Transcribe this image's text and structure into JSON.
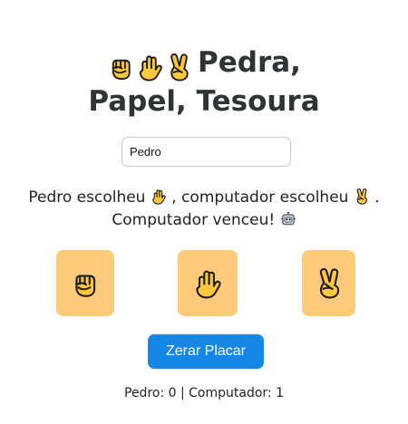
{
  "title": {
    "icons": [
      "rock-icon",
      "paper-hand-icon",
      "scissors-icon"
    ],
    "text": "Pedra, Papel, Tesoura"
  },
  "input": {
    "value": "Pedro",
    "placeholder": ""
  },
  "result": {
    "line1_start": "Pedro escolheu",
    "line1_middle": ", computador escolheu",
    "line1_end": ".",
    "player_choice_icon": "paper-hand-icon",
    "computer_choice_icon": "scissors-icon",
    "line2": "Computador venceu!",
    "winner_icon": "robot-icon"
  },
  "choices": [
    {
      "name": "pedra",
      "icon": "rock-icon"
    },
    {
      "name": "papel",
      "icon": "paper-hand-icon"
    },
    {
      "name": "tesoura",
      "icon": "scissors-icon"
    }
  ],
  "reset_button": {
    "label": "Zerar Placar"
  },
  "score": {
    "text": "Pedro: 0 | Computador: 1"
  },
  "colors": {
    "choice_background": "#ffcb7a",
    "reset_button": "#1787e6",
    "title_text": "#2f3437",
    "hand_yellow": "#ffc83d",
    "outline": "#1f1f1f"
  }
}
